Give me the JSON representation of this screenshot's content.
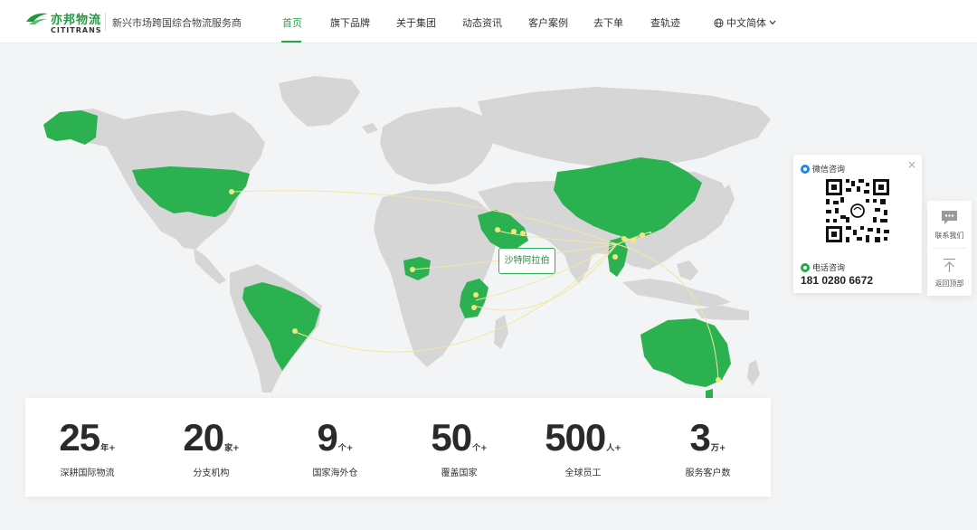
{
  "header": {
    "logo_cn": "亦邦物流",
    "logo_en": "CITITRANS",
    "tagline": "新兴市场跨国综合物流服务商",
    "nav": [
      {
        "label": "首页",
        "active": true
      },
      {
        "label": "旗下品牌",
        "active": false
      },
      {
        "label": "关于集团",
        "active": false
      },
      {
        "label": "动态资讯",
        "active": false
      },
      {
        "label": "客户案例",
        "active": false
      },
      {
        "label": "去下单",
        "active": false
      },
      {
        "label": "查轨迹",
        "active": false
      }
    ],
    "language": "中文简体"
  },
  "map": {
    "tooltip": "沙特阿拉伯",
    "highlight_color": "#2bb14f",
    "land_color": "#d6d6d6",
    "route_color": "#f3e6a0"
  },
  "stats": [
    {
      "value": "25",
      "unit": "年+",
      "label": "深耕国际物流"
    },
    {
      "value": "20",
      "unit": "家+",
      "label": "分支机构"
    },
    {
      "value": "9",
      "unit": "个+",
      "label": "国家海外仓"
    },
    {
      "value": "50",
      "unit": "个+",
      "label": "覆盖国家"
    },
    {
      "value": "500",
      "unit": "人+",
      "label": "全球员工"
    },
    {
      "value": "3",
      "unit": "万+",
      "label": "服务客户数"
    }
  ],
  "contact": {
    "wechat_label": "微信咨询",
    "phone_label": "电话咨询",
    "phone": "181 0280 6672",
    "close": "×"
  },
  "sidebar": {
    "contact_label": "联系我们",
    "top_label": "返回顶部"
  }
}
